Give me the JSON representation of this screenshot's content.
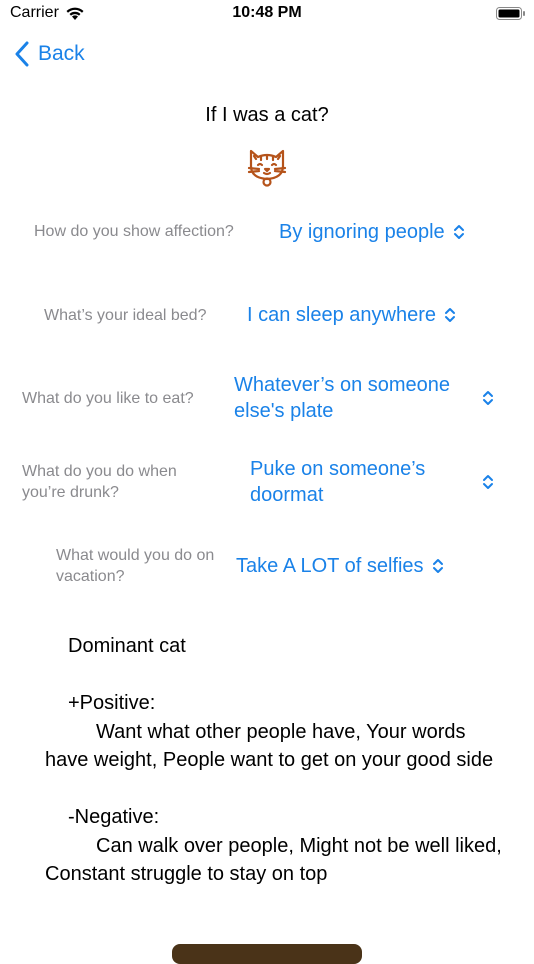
{
  "status_bar": {
    "carrier": "Carrier",
    "time": "10:48 PM"
  },
  "nav": {
    "back_label": "Back"
  },
  "title": "If I was a cat?",
  "colors": {
    "accent": "#1a82e8",
    "question": "#8a8a8e",
    "cat_icon": "#b5531a",
    "button": "#4a3318"
  },
  "questions": [
    {
      "question": "How do you show affection?",
      "answer": "By ignoring people"
    },
    {
      "question": "What’s your ideal bed?",
      "answer": "I can sleep anywhere"
    },
    {
      "question": "What do you like to eat?",
      "answer": "Whatever’s on someone else's plate"
    },
    {
      "question": "What do you do when you’re drunk?",
      "answer": "Puke on someone’s doormat"
    },
    {
      "question": "What would you do on vacation?",
      "answer": "Take A LOT of selfies"
    }
  ],
  "result": {
    "type": "Dominant cat",
    "positive_heading": "+Positive:",
    "positive_text": "Want what other people have, Your words have weight, People want to get on your good side",
    "negative_heading": "-Negative:",
    "negative_text": "Can walk over people, Might not be well liked, Constant struggle to stay on top"
  }
}
